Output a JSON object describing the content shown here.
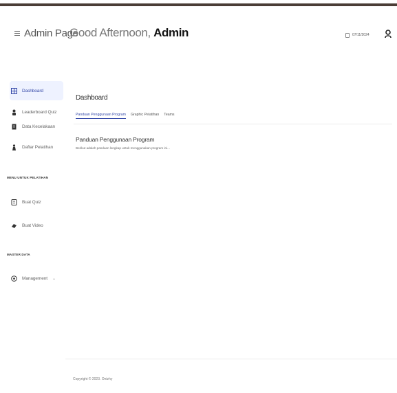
{
  "app": {
    "brand_title": "Admin Page"
  },
  "header": {
    "greeting_prefix": "Good Afternoon,",
    "greeting_name": "Admin",
    "date_value": "07/11/2024"
  },
  "sidebar": {
    "items": [
      {
        "label": "Dashboard",
        "icon": "dashboard-icon"
      },
      {
        "label": "Leaderboard Quiz",
        "icon": "user-icon"
      },
      {
        "label": "Data Kecelakaan",
        "icon": "document-icon"
      },
      {
        "label": "Daftar Pelatihan",
        "icon": "person-icon"
      }
    ],
    "section_training": "MENU UNTUK PELATIHAN",
    "training_items": [
      {
        "label": "Buat Quiz",
        "icon": "quiz-icon"
      },
      {
        "label": "Buat Video",
        "icon": "video-icon"
      }
    ],
    "section_master": "MASTER DATA",
    "master_items": [
      {
        "label": "Management",
        "icon": "settings-icon"
      }
    ]
  },
  "main": {
    "title": "Dashboard",
    "tabs": [
      {
        "label": "Panduan Penggunaan Program"
      },
      {
        "label": "Graphic Pelatihan"
      },
      {
        "label": "Teams"
      }
    ],
    "section_title": "Panduan Penggunaan Program",
    "section_desc": "Berikut adalah panduan lengkap untuk menggunakan program ini..."
  },
  "footer": {
    "copyright": "Copyright © 2023. Onizhy"
  },
  "colors": {
    "accent": "#3448a8",
    "active_bg": "#eef2ff",
    "top_bar": "#4a3d36"
  }
}
